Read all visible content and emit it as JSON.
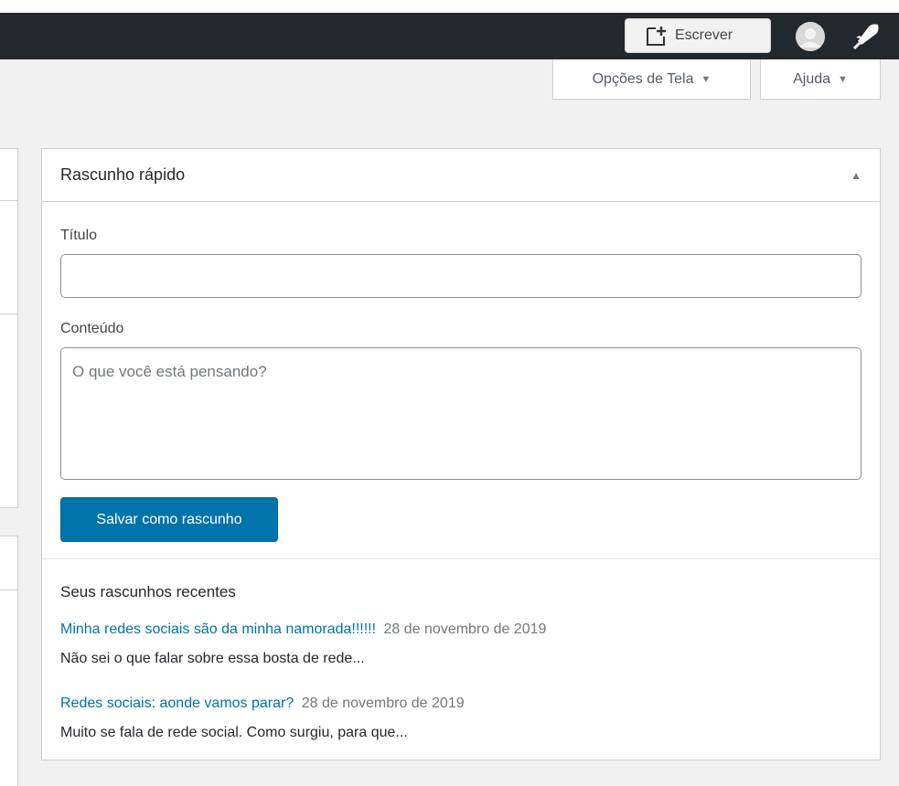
{
  "admin_bar": {
    "new_post_label": "Escrever"
  },
  "screen_meta": {
    "screen_options_label": "Opções de Tela",
    "help_label": "Ajuda",
    "dropdown_glyph": "▼"
  },
  "quick_draft": {
    "title": "Rascunho rápido",
    "toggle_glyph": "▲",
    "title_label": "Título",
    "title_value": "",
    "content_label": "Conteúdo",
    "content_placeholder": "O que você está pensando?",
    "save_label": "Salvar como rascunho",
    "recent_heading": "Seus rascunhos recentes",
    "recent_drafts": [
      {
        "title": "Minha redes sociais são da minha namorada!!!!!!",
        "date": "28 de novembro de 2019",
        "excerpt": "Não sei o que falar sobre essa bosta de rede..."
      },
      {
        "title": "Redes sociais: aonde vamos parar?",
        "date": "28 de novembro de 2019",
        "excerpt": "Muito se fala de rede social. Como surgiu, para que..."
      }
    ]
  },
  "colors": {
    "admin_bar": "#23282d",
    "primary_button": "#0073aa",
    "link": "#0073aa",
    "background": "#f1f1f1"
  },
  "icons": [
    "new-post-icon",
    "avatar-icon",
    "rocket-icon"
  ]
}
